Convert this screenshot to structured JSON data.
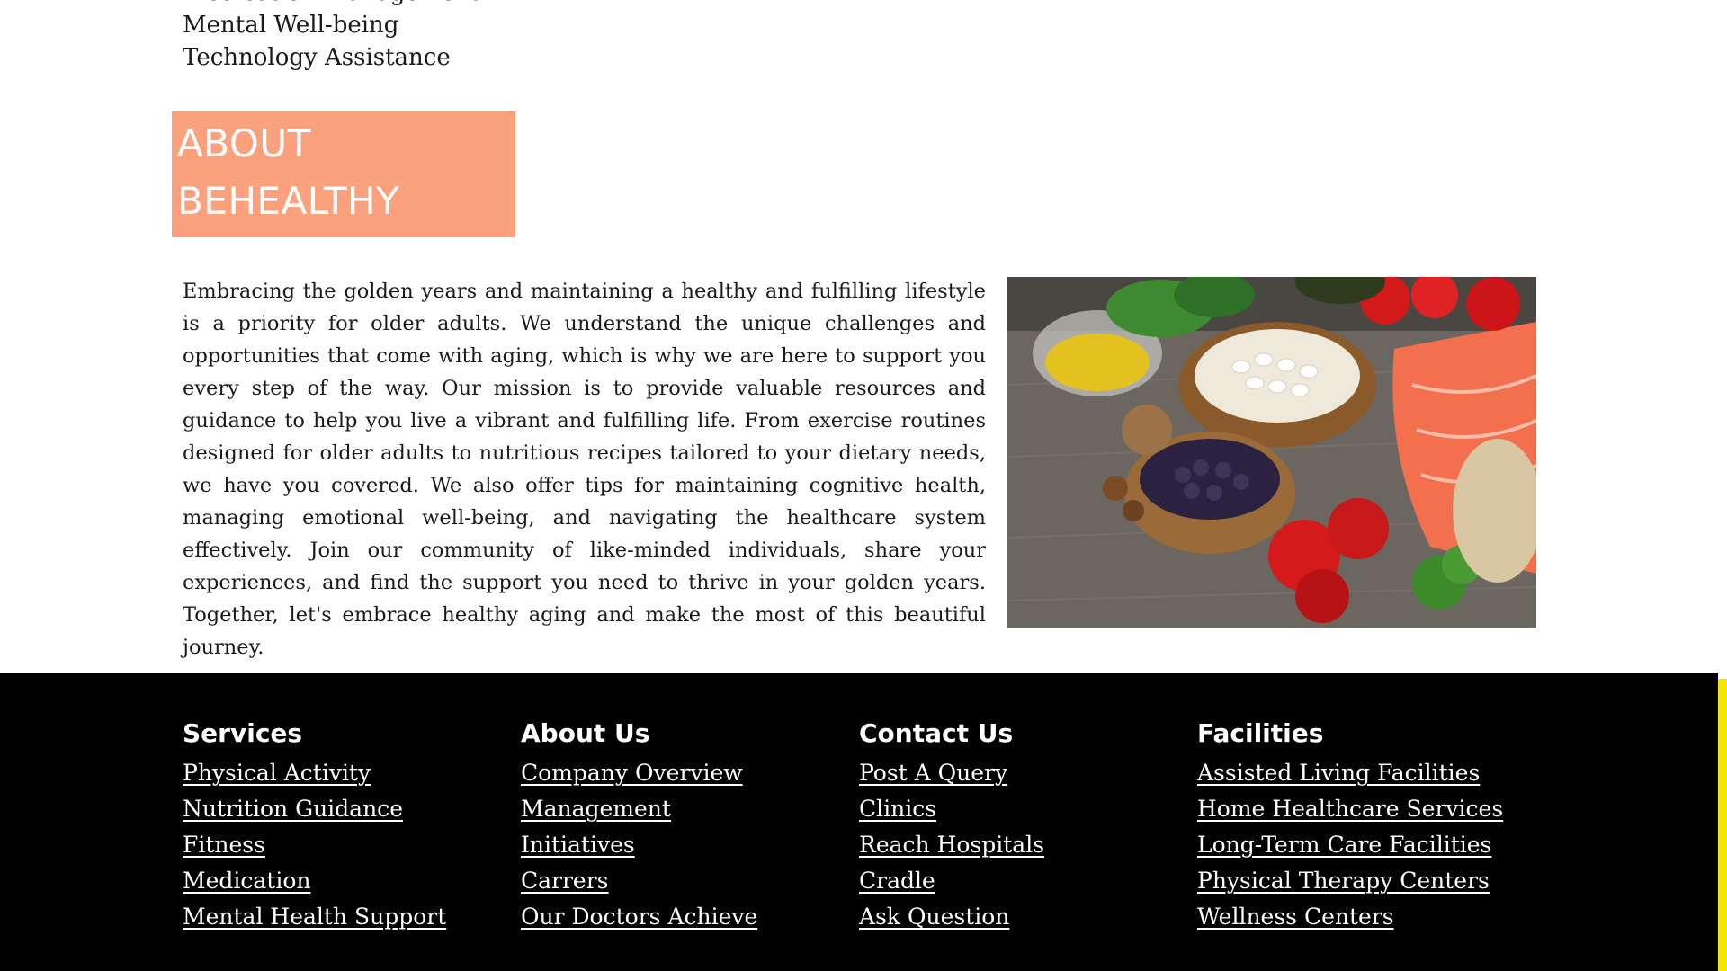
{
  "services_list": [
    "Medication Management",
    "Mental Well-being",
    "Technology Assistance"
  ],
  "about": {
    "heading_line1": "ABOUT",
    "heading_line2": "BEHEALTHY",
    "heading_bg": "#fca17d",
    "body": "Embracing the golden years and maintaining a healthy and fulfilling lifestyle is a priority for older adults. We understand the unique challenges and opportunities that come with aging, which is why we are here to support you every step of the way. Our mission is to provide valuable resources and guidance to help you live a vibrant and fulfilling life. From exercise routines designed for older adults to nutritious recipes tailored to your dietary needs, we have you covered. We also offer tips for maintaining cognitive health, managing emotional well-being, and navigating the healthcare system effectively. Join our community of like-minded individuals, share your experiences, and find the support you need to thrive in your golden years. Together, let's embrace healthy aging and make the most of this beautiful journey."
  },
  "footer": {
    "columns": [
      {
        "title": "Services",
        "links": [
          "Physical Activity",
          "Nutrition Guidance",
          "Fitness",
          "Medication",
          "Mental Health Support"
        ]
      },
      {
        "title": "About Us",
        "links": [
          "Company Overview",
          "Management",
          "Initiatives",
          "Carrers",
          "Our Doctors Achieve"
        ]
      },
      {
        "title": "Contact Us",
        "links": [
          "Post A Query",
          "Clinics",
          "Reach Hospitals",
          "Cradle",
          "Ask Question"
        ]
      },
      {
        "title": "Facilities",
        "links": [
          "Assisted Living Facilities",
          "Home Healthcare Services",
          "Long-Term Care Facilities",
          "Physical Therapy Centers",
          "Wellness Centers"
        ]
      }
    ]
  },
  "colors": {
    "footer_bg": "#000000",
    "scroll_thumb": "#f2e600"
  }
}
